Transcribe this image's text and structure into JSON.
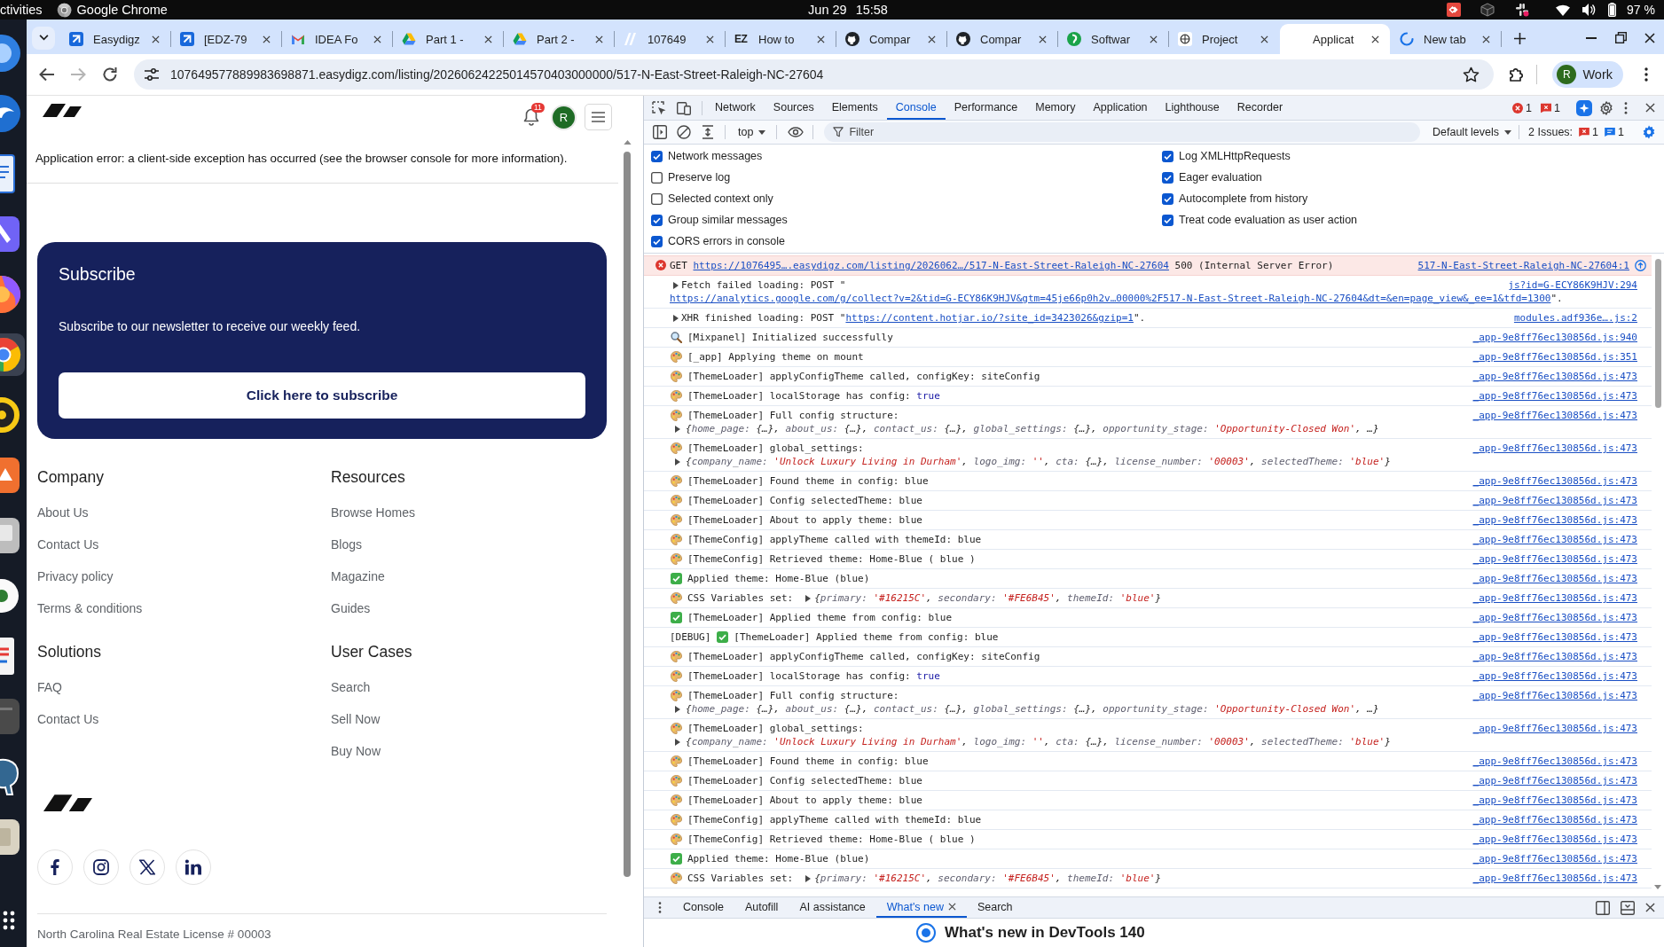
{
  "topbar": {
    "activities": "ctivities",
    "app_name": "Google Chrome",
    "date": "Jun 29",
    "time": "15:58",
    "battery": "97 %"
  },
  "dock": {
    "items": [
      {
        "selected": false
      },
      {
        "selected": false
      },
      {
        "selected": false
      },
      {
        "selected": false
      },
      {
        "selected": false
      },
      {
        "selected": true
      },
      {
        "selected": false
      },
      {
        "selected": false
      },
      {
        "selected": false
      },
      {
        "selected": false
      },
      {
        "selected": false
      },
      {
        "selected": false
      },
      {
        "selected": false
      },
      {
        "selected": false
      }
    ]
  },
  "browser": {
    "tabs": [
      {
        "title": "Easydigz",
        "selected": false,
        "loading": false
      },
      {
        "title": "[EDZ-79",
        "selected": false,
        "loading": false
      },
      {
        "title": "IDEA Fo",
        "selected": false,
        "loading": false
      },
      {
        "title": "Part 1 -",
        "selected": false,
        "loading": false
      },
      {
        "title": "Part 2 -",
        "selected": false,
        "loading": false
      },
      {
        "title": "107649",
        "selected": false,
        "loading": false
      },
      {
        "title": "How to",
        "favicon_text": "EZ",
        "selected": false,
        "loading": false
      },
      {
        "title": "Compar",
        "selected": false,
        "loading": false
      },
      {
        "title": "Compar",
        "selected": false,
        "loading": false
      },
      {
        "title": "Softwar",
        "selected": false,
        "loading": false
      },
      {
        "title": "Project",
        "selected": false,
        "loading": false
      },
      {
        "title": "Applicat",
        "selected": true,
        "loading": false
      },
      {
        "title": "New tab",
        "selected": false,
        "loading": true
      }
    ],
    "navigation": {
      "back_disabled": false,
      "forward_disabled": true
    },
    "address": "107649577889983698871.easydigz.com/listing/20260624225014570403000000/517-N-East-Street-Raleigh-NC-27604",
    "profile": {
      "initial": "R",
      "name": "Work"
    }
  },
  "page": {
    "notifications": "11",
    "avatar": "R",
    "error": "Application error: a client-side exception has occurred (see the browser console for more information).",
    "subscribe": {
      "title": "Subscribe",
      "text": "Subscribe to our newsletter to receive our weekly feed.",
      "button": "Click here to subscribe"
    },
    "footer": [
      {
        "heading": "Company",
        "links": [
          "About Us",
          "Contact Us",
          "Privacy policy",
          "Terms & conditions"
        ]
      },
      {
        "heading": "Resources",
        "links": [
          "Browse Homes",
          "Blogs",
          "Magazine",
          "Guides"
        ]
      },
      {
        "heading": "Solutions",
        "links": [
          "FAQ",
          "Contact Us"
        ]
      },
      {
        "heading": "User Cases",
        "links": [
          "Search",
          "Sell Now",
          "Buy Now"
        ]
      }
    ],
    "license": "North Carolina Real Estate License # 00003"
  },
  "devtools": {
    "tabs": [
      {
        "label": "Network",
        "selected": false
      },
      {
        "label": "Sources",
        "selected": false
      },
      {
        "label": "Elements",
        "selected": false
      },
      {
        "label": "Console",
        "selected": true
      },
      {
        "label": "Performance",
        "selected": false
      },
      {
        "label": "Memory",
        "selected": false
      },
      {
        "label": "Application",
        "selected": false
      },
      {
        "label": "Lighthouse",
        "selected": false
      },
      {
        "label": "Recorder",
        "selected": false
      }
    ],
    "error_count": "1",
    "issue_count": "1",
    "console_toolbar": {
      "context": "top",
      "filter_placeholder": "Filter",
      "levels": "Default levels",
      "issues_label": "2 Issues:",
      "issue_errors": "1",
      "issue_infos": "1"
    },
    "settings": [
      {
        "items": [
          {
            "label": "Network messages",
            "checked": true
          },
          {
            "label": "Preserve log",
            "checked": false
          },
          {
            "label": "Selected context only",
            "checked": false
          },
          {
            "label": "Group similar messages",
            "checked": true
          },
          {
            "label": "CORS errors in console",
            "checked": true
          }
        ]
      },
      {
        "items": [
          {
            "label": "Log XMLHttpRequests",
            "checked": true
          },
          {
            "label": "Eager evaluation",
            "checked": true
          },
          {
            "label": "Autocomplete from history",
            "checked": true
          },
          {
            "label": "Treat code evaluation as user action",
            "checked": true
          }
        ]
      }
    ],
    "messages": [
      {
        "kind": "error",
        "segments": [
          {
            "kind": "text",
            "text": "GET "
          },
          {
            "kind": "link",
            "text": "https://1076495….easydigz.com/listing/2026062…/517-N-East-Street-Raleigh-NC-27604"
          },
          {
            "kind": "text",
            "text": " 500 (Internal Server Error)"
          }
        ],
        "source": "517-N-East-Street-Raleigh-NC-27604:1"
      },
      {
        "kind": "network",
        "segments": [
          {
            "kind": "text",
            "text": "Fetch failed loading: POST \""
          }
        ],
        "continuation": [
          {
            "kind": "link",
            "text": "https://analytics.google.com/g/collect?v=2&tid=G-ECY86K9HJV&gtm=45je66p0h2v…00000%2F517-N-East-Street-Raleigh-NC-27604&dt=&en=page_view&_ee=1&tfd=1300"
          },
          {
            "kind": "text",
            "text": "\"."
          }
        ],
        "source": "js?id=G-ECY86K9HJV:294"
      },
      {
        "kind": "network",
        "segments": [
          {
            "kind": "text",
            "text": "XHR finished loading: POST \""
          },
          {
            "kind": "link",
            "text": "https://content.hotjar.io/?site_id=3423026&gzip=1"
          },
          {
            "kind": "text",
            "text": "\"."
          }
        ],
        "source": "modules.adf936e….js:2"
      },
      {
        "kind": "search",
        "segments": [
          {
            "kind": "text",
            "text": "[Mixpanel] Initialized successfully"
          }
        ],
        "source": "_app-9e8ff76ec130856d.js:940"
      },
      {
        "kind": "palette",
        "segments": [
          {
            "kind": "text",
            "text": "[_app] Applying theme on mount"
          }
        ],
        "source": "_app-9e8ff76ec130856d.js:351"
      },
      {
        "kind": "palette",
        "segments": [
          {
            "kind": "text",
            "text": "[ThemeLoader] applyConfigTheme called, configKey: siteConfig"
          }
        ],
        "source": "_app-9e8ff76ec130856d.js:473"
      },
      {
        "kind": "palette",
        "segments": [
          {
            "kind": "text",
            "text": "[ThemeLoader] localStorage has config: "
          },
          {
            "kind": "value",
            "text": "true"
          }
        ],
        "source": "_app-9e8ff76ec130856d.js:473"
      },
      {
        "kind": "palette",
        "segments": [
          {
            "kind": "text",
            "text": "[ThemeLoader] Full config structure:"
          }
        ],
        "object": {
          "inline": false,
          "segments": [
            {
              "kind": "text",
              "text": "{"
            },
            {
              "kind": "key",
              "text": "home_page: "
            },
            {
              "kind": "text",
              "text": "{…}, "
            },
            {
              "kind": "key",
              "text": "about_us: "
            },
            {
              "kind": "text",
              "text": "{…}, "
            },
            {
              "kind": "key",
              "text": "contact_us: "
            },
            {
              "kind": "text",
              "text": "{…}, "
            },
            {
              "kind": "key",
              "text": "global_settings: "
            },
            {
              "kind": "text",
              "text": "{…}, "
            },
            {
              "kind": "key",
              "text": "opportunity_stage: "
            },
            {
              "kind": "string",
              "text": "'Opportunity-Closed Won'"
            },
            {
              "kind": "text",
              "text": ", …}"
            }
          ]
        },
        "source": "_app-9e8ff76ec130856d.js:473"
      },
      {
        "kind": "palette",
        "segments": [
          {
            "kind": "text",
            "text": "[ThemeLoader] global_settings:"
          }
        ],
        "object": {
          "inline": false,
          "segments": [
            {
              "kind": "text",
              "text": "{"
            },
            {
              "kind": "key",
              "text": "company_name: "
            },
            {
              "kind": "string",
              "text": "'Unlock Luxury Living in Durham'"
            },
            {
              "kind": "text",
              "text": ", "
            },
            {
              "kind": "key",
              "text": "logo_img: "
            },
            {
              "kind": "string",
              "text": "''"
            },
            {
              "kind": "text",
              "text": ", "
            },
            {
              "kind": "key",
              "text": "cta: "
            },
            {
              "kind": "text",
              "text": "{…}, "
            },
            {
              "kind": "key",
              "text": "license_number: "
            },
            {
              "kind": "string",
              "text": "'00003'"
            },
            {
              "kind": "text",
              "text": ", "
            },
            {
              "kind": "key",
              "text": "selectedTheme: "
            },
            {
              "kind": "string",
              "text": "'blue'"
            },
            {
              "kind": "text",
              "text": "}"
            }
          ]
        },
        "source": "_app-9e8ff76ec130856d.js:473"
      },
      {
        "kind": "palette",
        "segments": [
          {
            "kind": "text",
            "text": "[ThemeLoader] Found theme in config: blue"
          }
        ],
        "source": "_app-9e8ff76ec130856d.js:473"
      },
      {
        "kind": "palette",
        "segments": [
          {
            "kind": "text",
            "text": "[ThemeLoader] Config selectedTheme: blue"
          }
        ],
        "source": "_app-9e8ff76ec130856d.js:473"
      },
      {
        "kind": "palette",
        "segments": [
          {
            "kind": "text",
            "text": "[ThemeLoader] About to apply theme: blue"
          }
        ],
        "source": "_app-9e8ff76ec130856d.js:473"
      },
      {
        "kind": "palette",
        "segments": [
          {
            "kind": "text",
            "text": "[ThemeConfig] applyTheme called with themeId: blue"
          }
        ],
        "source": "_app-9e8ff76ec130856d.js:473"
      },
      {
        "kind": "palette",
        "segments": [
          {
            "kind": "text",
            "text": "[ThemeConfig] Retrieved theme: Home-Blue ( blue )"
          }
        ],
        "source": "_app-9e8ff76ec130856d.js:473"
      },
      {
        "kind": "check",
        "segments": [
          {
            "kind": "text",
            "text": "Applied theme: Home-Blue (blue)"
          }
        ],
        "source": "_app-9e8ff76ec130856d.js:473"
      },
      {
        "kind": "palette",
        "segments": [
          {
            "kind": "text",
            "text": "CSS Variables set:"
          }
        ],
        "object": {
          "inline": true,
          "segments": [
            {
              "kind": "text",
              "text": "{"
            },
            {
              "kind": "key",
              "text": "primary: "
            },
            {
              "kind": "string",
              "text": "'#16215C'"
            },
            {
              "kind": "text",
              "text": ", "
            },
            {
              "kind": "key",
              "text": "secondary: "
            },
            {
              "kind": "string",
              "text": "'#FE6B45'"
            },
            {
              "kind": "text",
              "text": ", "
            },
            {
              "kind": "key",
              "text": "themeId: "
            },
            {
              "kind": "string",
              "text": "'blue'"
            },
            {
              "kind": "text",
              "text": "}"
            }
          ]
        },
        "source": "_app-9e8ff76ec130856d.js:473"
      },
      {
        "kind": "check",
        "segments": [
          {
            "kind": "text",
            "text": "[ThemeLoader] Applied theme from config: blue"
          }
        ],
        "source": "_app-9e8ff76ec130856d.js:473"
      },
      {
        "kind": "check",
        "prefix": "[DEBUG]",
        "segments": [
          {
            "kind": "text",
            "text": "[ThemeLoader] Applied theme from config: blue"
          }
        ],
        "source": "_app-9e8ff76ec130856d.js:473"
      },
      {
        "kind": "palette",
        "segments": [
          {
            "kind": "text",
            "text": "[ThemeLoader] applyConfigTheme called, configKey: siteConfig"
          }
        ],
        "source": "_app-9e8ff76ec130856d.js:473"
      },
      {
        "kind": "palette",
        "segments": [
          {
            "kind": "text",
            "text": "[ThemeLoader] localStorage has config: "
          },
          {
            "kind": "value",
            "text": "true"
          }
        ],
        "source": "_app-9e8ff76ec130856d.js:473"
      },
      {
        "kind": "palette",
        "segments": [
          {
            "kind": "text",
            "text": "[ThemeLoader] Full config structure:"
          }
        ],
        "object": {
          "inline": false,
          "segments": [
            {
              "kind": "text",
              "text": "{"
            },
            {
              "kind": "key",
              "text": "home_page: "
            },
            {
              "kind": "text",
              "text": "{…}, "
            },
            {
              "kind": "key",
              "text": "about_us: "
            },
            {
              "kind": "text",
              "text": "{…}, "
            },
            {
              "kind": "key",
              "text": "contact_us: "
            },
            {
              "kind": "text",
              "text": "{…}, "
            },
            {
              "kind": "key",
              "text": "global_settings: "
            },
            {
              "kind": "text",
              "text": "{…}, "
            },
            {
              "kind": "key",
              "text": "opportunity_stage: "
            },
            {
              "kind": "string",
              "text": "'Opportunity-Closed Won'"
            },
            {
              "kind": "text",
              "text": ", …}"
            }
          ]
        },
        "source": "_app-9e8ff76ec130856d.js:473"
      },
      {
        "kind": "palette",
        "segments": [
          {
            "kind": "text",
            "text": "[ThemeLoader] global_settings:"
          }
        ],
        "object": {
          "inline": false,
          "segments": [
            {
              "kind": "text",
              "text": "{"
            },
            {
              "kind": "key",
              "text": "company_name: "
            },
            {
              "kind": "string",
              "text": "'Unlock Luxury Living in Durham'"
            },
            {
              "kind": "text",
              "text": ", "
            },
            {
              "kind": "key",
              "text": "logo_img: "
            },
            {
              "kind": "string",
              "text": "''"
            },
            {
              "kind": "text",
              "text": ", "
            },
            {
              "kind": "key",
              "text": "cta: "
            },
            {
              "kind": "text",
              "text": "{…}, "
            },
            {
              "kind": "key",
              "text": "license_number: "
            },
            {
              "kind": "string",
              "text": "'00003'"
            },
            {
              "kind": "text",
              "text": ", "
            },
            {
              "kind": "key",
              "text": "selectedTheme: "
            },
            {
              "kind": "string",
              "text": "'blue'"
            },
            {
              "kind": "text",
              "text": "}"
            }
          ]
        },
        "source": "_app-9e8ff76ec130856d.js:473"
      },
      {
        "kind": "palette",
        "segments": [
          {
            "kind": "text",
            "text": "[ThemeLoader] Found theme in config: blue"
          }
        ],
        "source": "_app-9e8ff76ec130856d.js:473"
      },
      {
        "kind": "palette",
        "segments": [
          {
            "kind": "text",
            "text": "[ThemeLoader] Config selectedTheme: blue"
          }
        ],
        "source": "_app-9e8ff76ec130856d.js:473"
      },
      {
        "kind": "palette",
        "segments": [
          {
            "kind": "text",
            "text": "[ThemeLoader] About to apply theme: blue"
          }
        ],
        "source": "_app-9e8ff76ec130856d.js:473"
      },
      {
        "kind": "palette",
        "segments": [
          {
            "kind": "text",
            "text": "[ThemeConfig] applyTheme called with themeId: blue"
          }
        ],
        "source": "_app-9e8ff76ec130856d.js:473"
      },
      {
        "kind": "palette",
        "segments": [
          {
            "kind": "text",
            "text": "[ThemeConfig] Retrieved theme: Home-Blue ( blue )"
          }
        ],
        "source": "_app-9e8ff76ec130856d.js:473"
      },
      {
        "kind": "check",
        "segments": [
          {
            "kind": "text",
            "text": "Applied theme: Home-Blue (blue)"
          }
        ],
        "source": "_app-9e8ff76ec130856d.js:473"
      },
      {
        "kind": "palette",
        "segments": [
          {
            "kind": "text",
            "text": "CSS Variables set:"
          }
        ],
        "object": {
          "inline": true,
          "segments": [
            {
              "kind": "text",
              "text": "{"
            },
            {
              "kind": "key",
              "text": "primary: "
            },
            {
              "kind": "string",
              "text": "'#16215C'"
            },
            {
              "kind": "text",
              "text": ", "
            },
            {
              "kind": "key",
              "text": "secondary: "
            },
            {
              "kind": "string",
              "text": "'#FE6B45'"
            },
            {
              "kind": "text",
              "text": ", "
            },
            {
              "kind": "key",
              "text": "themeId: "
            },
            {
              "kind": "string",
              "text": "'blue'"
            },
            {
              "kind": "text",
              "text": "}"
            }
          ]
        },
        "source": "_app-9e8ff76ec130856d.js:473"
      }
    ],
    "drawer": {
      "tabs": [
        {
          "label": "Console",
          "selected": false,
          "closable": false
        },
        {
          "label": "Autofill",
          "selected": false,
          "closable": false
        },
        {
          "label": "AI assistance",
          "selected": false,
          "closable": false
        },
        {
          "label": "What's new",
          "selected": true,
          "closable": true
        },
        {
          "label": "Search",
          "selected": false,
          "closable": false
        }
      ],
      "heading": "What's new in DevTools 140"
    }
  }
}
